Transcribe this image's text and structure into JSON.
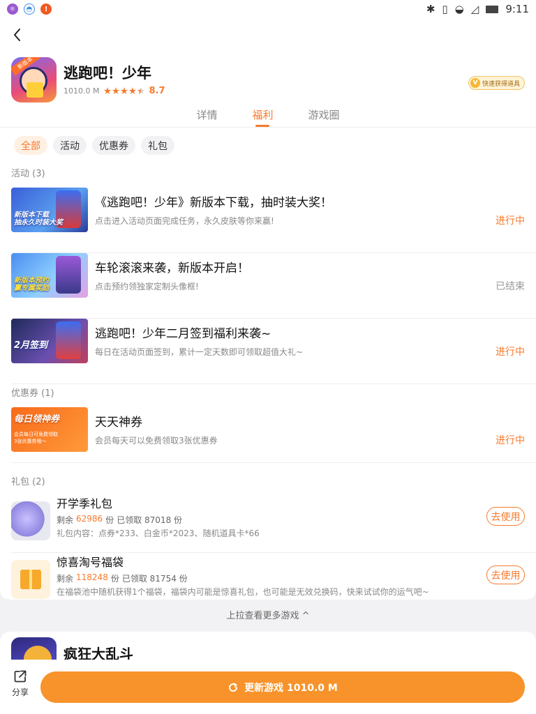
{
  "status_bar": {
    "time": "9:11"
  },
  "app": {
    "name": "逃跑吧！少年",
    "size": "1010.0 M",
    "rating": "8.7",
    "stars": 4.5,
    "quick_badge": "快速获得道具",
    "badge_text": "新版本"
  },
  "tabs": [
    {
      "label": "详情",
      "active": false
    },
    {
      "label": "福利",
      "active": true
    },
    {
      "label": "游戏圈",
      "active": false
    }
  ],
  "filters": [
    {
      "label": "全部",
      "active": true
    },
    {
      "label": "活动",
      "active": false
    },
    {
      "label": "优惠券",
      "active": false
    },
    {
      "label": "礼包",
      "active": false
    }
  ],
  "sections": {
    "activities_title": "活动 (3)",
    "coupons_title": "优惠券 (1)",
    "gifts_title": "礼包 (2)"
  },
  "activities": [
    {
      "title": "《逃跑吧！少年》新版本下载，抽时装大奖！",
      "desc": "点击进入活动页面完成任务，永久皮肤等你来赢!",
      "status": "进行中",
      "thumb_text": "新版本下载\n抽永久时装大奖"
    },
    {
      "title": "车轮滚滚来袭，新版本开启！",
      "desc": "点击预约领独家定制头像框!",
      "status": "已结束",
      "thumb_text": "新版本预约\n赢专属奖励"
    },
    {
      "title": "逃跑吧！少年二月签到福利来袭~",
      "desc": "每日在活动页面签到，累计一定天数即可领取超值大礼~",
      "status": "进行中",
      "thumb_text": "2月签到"
    }
  ],
  "coupons": [
    {
      "title": "天天神券",
      "desc": "会员每天可以免费领取3张优惠券",
      "status": "进行中",
      "thumb_text": "每日领神券",
      "thumb_sub": "会员每日可免费领取\n3张优惠券哦～"
    }
  ],
  "gifts": [
    {
      "title": "开学季礼包",
      "remaining_label": "剩余",
      "remaining": "62986",
      "unit": "份",
      "claimed": "已领取 87018 份",
      "content": "礼包内容：点券*233、白金币*2023、随机道具卡*66",
      "button": "去使用"
    },
    {
      "title": "惊喜淘号福袋",
      "remaining_label": "剩余",
      "remaining": "118248",
      "unit": "份",
      "claimed": "已领取 81754 份",
      "content": "在福袋池中随机获得1个福袋，福袋内可能是惊喜礼包，也可能是无效兑换码，快来试试你的运气吧~",
      "button": "去使用"
    }
  ],
  "more_tip": "上拉查看更多游戏 ^",
  "next_game": {
    "name": "疯狂大乱斗"
  },
  "bottom": {
    "share_label": "分享",
    "update_label": "更新游戏 1010.0 M"
  },
  "colors": {
    "accent": "#f77a2c",
    "button": "#f7932a"
  }
}
